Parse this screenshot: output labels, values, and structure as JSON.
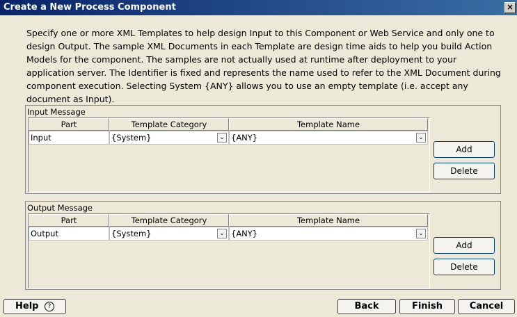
{
  "window": {
    "title": "Create a New Process Component",
    "close": "×"
  },
  "description": "Specify one or more XML Templates to help design Input to this Component or Web Service and only one to design Output.  The sample XML Documents in each Template are design time aids to help you build Action Models for the component.  The samples are not actually used at runtime after deployment to your application server.  The Identifier is fixed and represents the name used to refer to the XML Document during component execution.  Selecting System {ANY} allows you to use an empty template (i.e. accept any document as Input).",
  "input": {
    "title": "Input Message",
    "columns": [
      "Part",
      "Template Category",
      "Template Name"
    ],
    "row": {
      "part": "Input",
      "category": "{System}",
      "name": "{ANY}"
    },
    "add": "Add",
    "delete": "Delete"
  },
  "output": {
    "title": "Output Message",
    "columns": [
      "Part",
      "Template Category",
      "Template Name"
    ],
    "row": {
      "part": "Output",
      "category": "{System}",
      "name": "{ANY}"
    },
    "add": "Add",
    "delete": "Delete"
  },
  "footer": {
    "help": "Help",
    "help_icon": "?",
    "back": "Back",
    "finish": "Finish",
    "cancel": "Cancel"
  },
  "icons": {
    "dropdown": "chevron-down-icon",
    "help": "question-circle-icon"
  }
}
